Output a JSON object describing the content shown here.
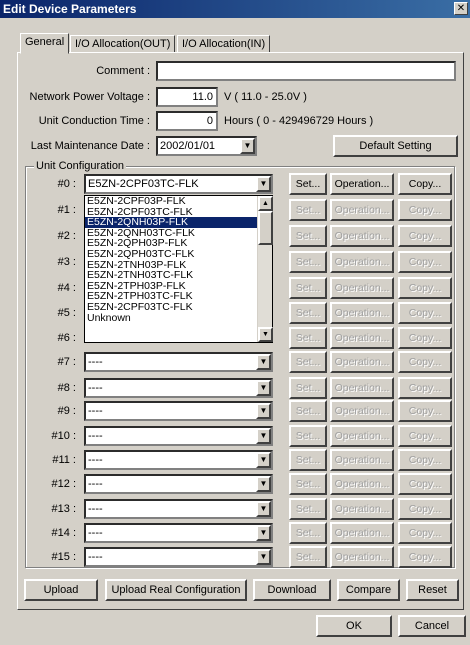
{
  "window": {
    "title": "Edit Device Parameters",
    "close_glyph": "✕"
  },
  "tabs": [
    "General",
    "I/O Allocation(OUT)",
    "I/O Allocation(IN)"
  ],
  "comment": {
    "label": "Comment :",
    "value": ""
  },
  "network_voltage": {
    "label": "Network Power Voltage :",
    "value": "11.0",
    "hint": "V ( 11.0 - 25.0V )"
  },
  "conduction_time": {
    "label": "Unit Conduction Time :",
    "value": "0",
    "hint": "Hours ( 0 - 429496729 Hours )"
  },
  "maintenance": {
    "label": "Last Maintenance Date :",
    "value": "2002/01/01"
  },
  "default_setting": "Default Setting",
  "unit_config": {
    "title": "Unit Configuration",
    "rows": [
      {
        "label": "#0 :",
        "value": "E5ZN-2CPF03TC-FLK",
        "enabled": true
      },
      {
        "label": "#1 :",
        "value": "",
        "enabled": false
      },
      {
        "label": "#2 :",
        "value": "",
        "enabled": false
      },
      {
        "label": "#3 :",
        "value": "",
        "enabled": false
      },
      {
        "label": "#4 :",
        "value": "",
        "enabled": false
      },
      {
        "label": "#5 :",
        "value": "",
        "enabled": false
      },
      {
        "label": "#6 :",
        "value": "",
        "enabled": false
      },
      {
        "label": "#7 :",
        "value": "----",
        "enabled": false
      },
      {
        "label": "#8 :",
        "value": "----",
        "enabled": false
      },
      {
        "label": "#9 :",
        "value": "----",
        "enabled": false
      },
      {
        "label": "#10 :",
        "value": "----",
        "enabled": false
      },
      {
        "label": "#11 :",
        "value": "----",
        "enabled": false
      },
      {
        "label": "#12 :",
        "value": "----",
        "enabled": false
      },
      {
        "label": "#13 :",
        "value": "----",
        "enabled": false
      },
      {
        "label": "#14 :",
        "value": "----",
        "enabled": false
      },
      {
        "label": "#15 :",
        "value": "----",
        "enabled": false
      }
    ],
    "set_label": "Set...",
    "operation_label": "Operation...",
    "copy_label": "Copy..."
  },
  "dropdown_options": [
    "E5ZN-2CPF03P-FLK",
    "E5ZN-2CPF03TC-FLK",
    "E5ZN-2QNH03P-FLK",
    "E5ZN-2QNH03TC-FLK",
    "E5ZN-2QPH03P-FLK",
    "E5ZN-2QPH03TC-FLK",
    "E5ZN-2TNH03P-FLK",
    "E5ZN-2TNH03TC-FLK",
    "E5ZN-2TPH03P-FLK",
    "E5ZN-2TPH03TC-FLK",
    "E5ZN-2CPF03TC-FLK",
    "Unknown"
  ],
  "dropdown_selected_index": 2,
  "bottom_buttons": [
    "Upload",
    "Upload Real Configuration",
    "Download",
    "Compare",
    "Reset"
  ],
  "dialog_buttons": {
    "ok": "OK",
    "cancel": "Cancel"
  },
  "colors": {
    "selection": "#0a246a",
    "face": "#d4d0c8"
  }
}
